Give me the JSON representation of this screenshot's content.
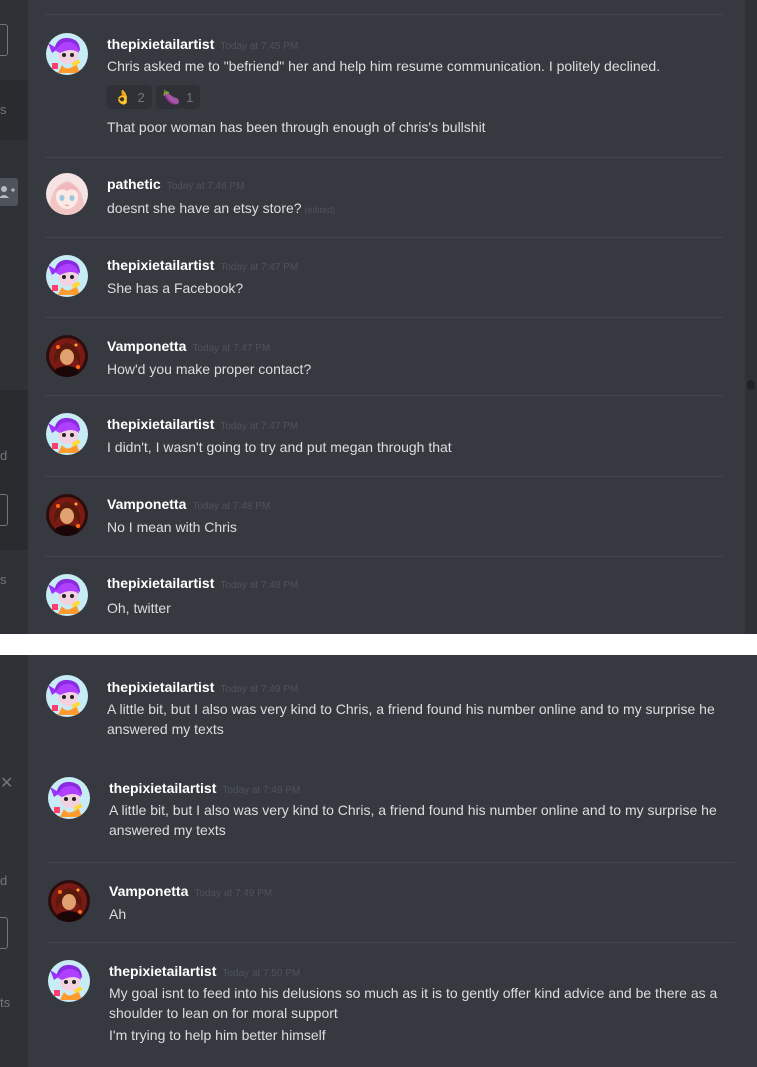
{
  "sidebar_fragments": [
    "s",
    "d",
    "s",
    "d",
    "ts"
  ],
  "messages_top": [
    {
      "username": "thepixietailartist",
      "timestamp": "Today at 7:45 PM",
      "avatar": "pixie-avatar",
      "lines": [
        "Chris asked me to \"befriend\" her and help him resume communication. I politely declined."
      ],
      "reactions": [
        {
          "emoji": "ok-hand",
          "glyph": "👌",
          "count": "2"
        },
        {
          "emoji": "eggplant",
          "glyph": "🍆",
          "count": "1"
        }
      ],
      "followup": "That poor woman has been through enough of chris's bullshit"
    },
    {
      "username": "pathetic",
      "timestamp": "Today at 7:46 PM",
      "avatar": "anime-girl-avatar",
      "lines": [
        "doesnt she have an etsy store?"
      ],
      "edited": "(edited)"
    },
    {
      "username": "thepixietailartist",
      "timestamp": "Today at 7:47 PM",
      "avatar": "pixie-avatar",
      "lines": [
        "She has a Facebook?"
      ]
    },
    {
      "username": "Vamponetta",
      "timestamp": "Today at 7:47 PM",
      "avatar": "vamp-avatar",
      "lines": [
        "How'd you make proper contact?"
      ]
    },
    {
      "username": "thepixietailartist",
      "timestamp": "Today at 7:47 PM",
      "avatar": "pixie-avatar",
      "lines": [
        "I didn't, I wasn't going to try and put megan through that"
      ]
    },
    {
      "username": "Vamponetta",
      "timestamp": "Today at 7:48 PM",
      "avatar": "vamp-avatar",
      "lines": [
        "No I mean with Chris"
      ]
    },
    {
      "username": "thepixietailartist",
      "timestamp": "Today at 7:48 PM",
      "avatar": "pixie-avatar",
      "lines": [
        "Oh, twitter"
      ]
    }
  ],
  "messages_bottom": [
    {
      "username": "thepixietailartist",
      "timestamp": "Today at 7:49 PM",
      "avatar": "pixie-avatar",
      "lines": [
        "A little bit, but I also was very kind to Chris, a friend found his number online and to my surprise he answered my texts"
      ]
    },
    {
      "username": "thepixietailartist",
      "timestamp": "Today at 7:49 PM",
      "avatar": "pixie-avatar",
      "lines": [
        "A little bit, but I also was very kind to Chris, a friend found his number online and to my surprise he answered my texts"
      ]
    },
    {
      "username": "Vamponetta",
      "timestamp": "Today at 7:49 PM",
      "avatar": "vamp-avatar",
      "lines": [
        "Ah"
      ]
    },
    {
      "username": "thepixietailartist",
      "timestamp": "Today at 7:50 PM",
      "avatar": "pixie-avatar",
      "lines": [
        "My goal isnt to feed into his delusions so much as it is to gently offer kind advice and be there as a shoulder to lean on for moral support",
        "I'm trying to help him better himself"
      ]
    }
  ],
  "colors": {
    "chat_bg": "#36393f",
    "sidebar_bg": "#2f3136",
    "username": "#ffffff",
    "text": "#dcddde",
    "timestamp": "#4f535a"
  }
}
